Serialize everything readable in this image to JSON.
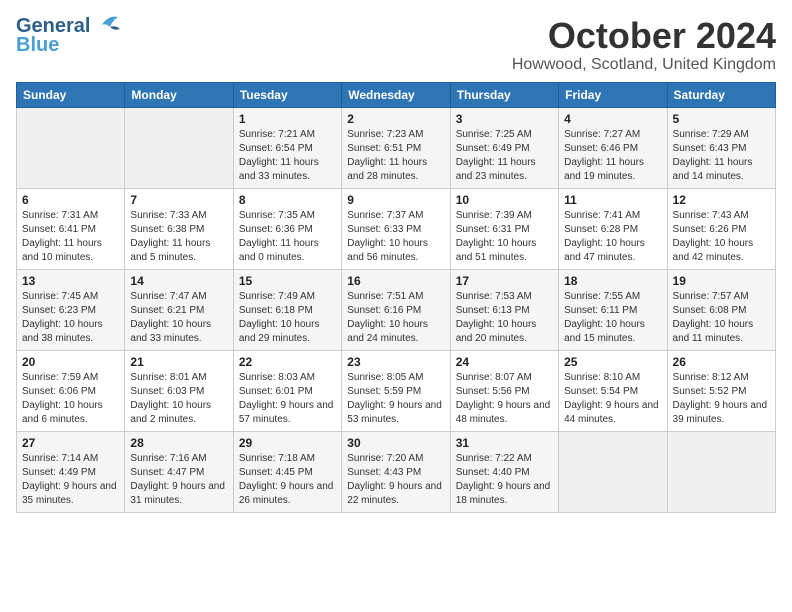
{
  "logo": {
    "line1": "General",
    "line2": "Blue"
  },
  "title": "October 2024",
  "location": "Howwood, Scotland, United Kingdom",
  "days_of_week": [
    "Sunday",
    "Monday",
    "Tuesday",
    "Wednesday",
    "Thursday",
    "Friday",
    "Saturday"
  ],
  "weeks": [
    [
      {
        "day": "",
        "info": ""
      },
      {
        "day": "",
        "info": ""
      },
      {
        "day": "1",
        "info": "Sunrise: 7:21 AM\nSunset: 6:54 PM\nDaylight: 11 hours and 33 minutes."
      },
      {
        "day": "2",
        "info": "Sunrise: 7:23 AM\nSunset: 6:51 PM\nDaylight: 11 hours and 28 minutes."
      },
      {
        "day": "3",
        "info": "Sunrise: 7:25 AM\nSunset: 6:49 PM\nDaylight: 11 hours and 23 minutes."
      },
      {
        "day": "4",
        "info": "Sunrise: 7:27 AM\nSunset: 6:46 PM\nDaylight: 11 hours and 19 minutes."
      },
      {
        "day": "5",
        "info": "Sunrise: 7:29 AM\nSunset: 6:43 PM\nDaylight: 11 hours and 14 minutes."
      }
    ],
    [
      {
        "day": "6",
        "info": "Sunrise: 7:31 AM\nSunset: 6:41 PM\nDaylight: 11 hours and 10 minutes."
      },
      {
        "day": "7",
        "info": "Sunrise: 7:33 AM\nSunset: 6:38 PM\nDaylight: 11 hours and 5 minutes."
      },
      {
        "day": "8",
        "info": "Sunrise: 7:35 AM\nSunset: 6:36 PM\nDaylight: 11 hours and 0 minutes."
      },
      {
        "day": "9",
        "info": "Sunrise: 7:37 AM\nSunset: 6:33 PM\nDaylight: 10 hours and 56 minutes."
      },
      {
        "day": "10",
        "info": "Sunrise: 7:39 AM\nSunset: 6:31 PM\nDaylight: 10 hours and 51 minutes."
      },
      {
        "day": "11",
        "info": "Sunrise: 7:41 AM\nSunset: 6:28 PM\nDaylight: 10 hours and 47 minutes."
      },
      {
        "day": "12",
        "info": "Sunrise: 7:43 AM\nSunset: 6:26 PM\nDaylight: 10 hours and 42 minutes."
      }
    ],
    [
      {
        "day": "13",
        "info": "Sunrise: 7:45 AM\nSunset: 6:23 PM\nDaylight: 10 hours and 38 minutes."
      },
      {
        "day": "14",
        "info": "Sunrise: 7:47 AM\nSunset: 6:21 PM\nDaylight: 10 hours and 33 minutes."
      },
      {
        "day": "15",
        "info": "Sunrise: 7:49 AM\nSunset: 6:18 PM\nDaylight: 10 hours and 29 minutes."
      },
      {
        "day": "16",
        "info": "Sunrise: 7:51 AM\nSunset: 6:16 PM\nDaylight: 10 hours and 24 minutes."
      },
      {
        "day": "17",
        "info": "Sunrise: 7:53 AM\nSunset: 6:13 PM\nDaylight: 10 hours and 20 minutes."
      },
      {
        "day": "18",
        "info": "Sunrise: 7:55 AM\nSunset: 6:11 PM\nDaylight: 10 hours and 15 minutes."
      },
      {
        "day": "19",
        "info": "Sunrise: 7:57 AM\nSunset: 6:08 PM\nDaylight: 10 hours and 11 minutes."
      }
    ],
    [
      {
        "day": "20",
        "info": "Sunrise: 7:59 AM\nSunset: 6:06 PM\nDaylight: 10 hours and 6 minutes."
      },
      {
        "day": "21",
        "info": "Sunrise: 8:01 AM\nSunset: 6:03 PM\nDaylight: 10 hours and 2 minutes."
      },
      {
        "day": "22",
        "info": "Sunrise: 8:03 AM\nSunset: 6:01 PM\nDaylight: 9 hours and 57 minutes."
      },
      {
        "day": "23",
        "info": "Sunrise: 8:05 AM\nSunset: 5:59 PM\nDaylight: 9 hours and 53 minutes."
      },
      {
        "day": "24",
        "info": "Sunrise: 8:07 AM\nSunset: 5:56 PM\nDaylight: 9 hours and 48 minutes."
      },
      {
        "day": "25",
        "info": "Sunrise: 8:10 AM\nSunset: 5:54 PM\nDaylight: 9 hours and 44 minutes."
      },
      {
        "day": "26",
        "info": "Sunrise: 8:12 AM\nSunset: 5:52 PM\nDaylight: 9 hours and 39 minutes."
      }
    ],
    [
      {
        "day": "27",
        "info": "Sunrise: 7:14 AM\nSunset: 4:49 PM\nDaylight: 9 hours and 35 minutes."
      },
      {
        "day": "28",
        "info": "Sunrise: 7:16 AM\nSunset: 4:47 PM\nDaylight: 9 hours and 31 minutes."
      },
      {
        "day": "29",
        "info": "Sunrise: 7:18 AM\nSunset: 4:45 PM\nDaylight: 9 hours and 26 minutes."
      },
      {
        "day": "30",
        "info": "Sunrise: 7:20 AM\nSunset: 4:43 PM\nDaylight: 9 hours and 22 minutes."
      },
      {
        "day": "31",
        "info": "Sunrise: 7:22 AM\nSunset: 4:40 PM\nDaylight: 9 hours and 18 minutes."
      },
      {
        "day": "",
        "info": ""
      },
      {
        "day": "",
        "info": ""
      }
    ]
  ]
}
